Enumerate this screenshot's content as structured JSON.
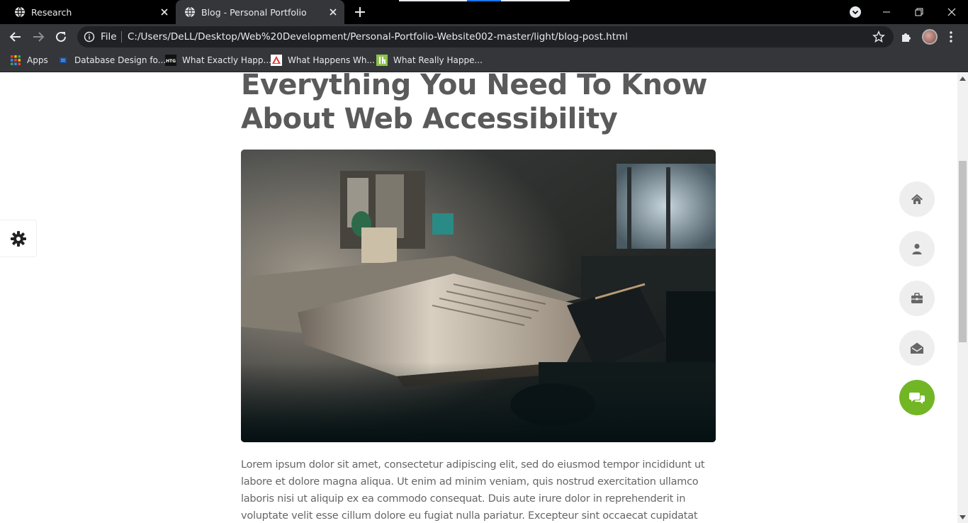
{
  "browser": {
    "tabs": [
      {
        "title": "Research",
        "active": false
      },
      {
        "title": "Blog - Personal Portfolio",
        "active": true
      }
    ],
    "omnibox": {
      "scheme_label": "File",
      "url": "C:/Users/DeLL/Desktop/Web%20Development/Personal-Portfolio-Website002-master/light/blog-post.html"
    },
    "bookmarks": [
      {
        "label": "Apps",
        "icon": "apps-grid-icon"
      },
      {
        "label": "Database Design fo...",
        "icon": "database-favicon"
      },
      {
        "label": "What Exactly Happ...",
        "icon": "htg-favicon"
      },
      {
        "label": "What Happens Wh...",
        "icon": "triangle-favicon"
      },
      {
        "label": "What Really Happe...",
        "icon": "lh-favicon"
      }
    ]
  },
  "page": {
    "post_title": "Everything You Need To Know About Web Accessibility",
    "hero_image_alt": "dimly lit desk with an open book",
    "body_text": "Lorem ipsum dolor sit amet, consectetur adipiscing elit, sed do eiusmod tempor incididunt ut labore et dolore magna aliqua. Ut enim ad minim veniam, quis nostrud exercitation ullamco laboris nisi ut aliquip ex ea commodo consequat. Duis aute irure dolor in reprehenderit in voluptate velit esse cillum dolore eu fugiat nulla pariatur. Excepteur sint occaecat cupidatat non",
    "side_nav": [
      {
        "name": "home",
        "icon": "home-icon",
        "active": false
      },
      {
        "name": "about",
        "icon": "user-icon",
        "active": false
      },
      {
        "name": "portfolio",
        "icon": "briefcase-icon",
        "active": false
      },
      {
        "name": "contact",
        "icon": "envelope-open-icon",
        "active": false
      },
      {
        "name": "blog",
        "icon": "comments-icon",
        "active": true
      }
    ],
    "colors": {
      "accent": "#72b626",
      "title": "#5a5a5a",
      "text": "#666666",
      "nav_bg": "#eeeeee"
    }
  }
}
